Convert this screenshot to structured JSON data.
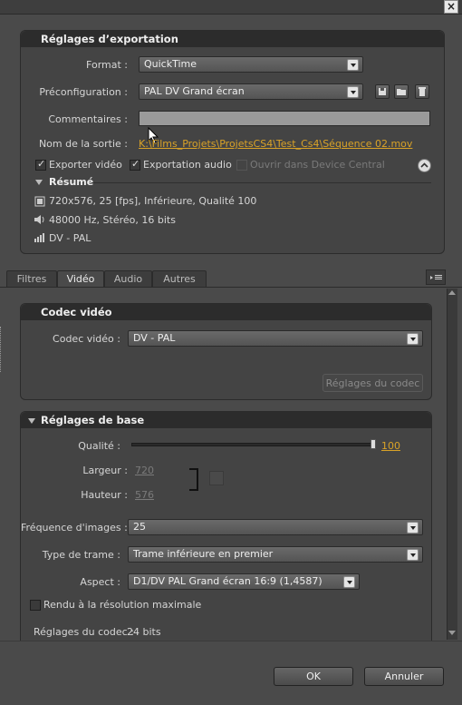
{
  "window": {
    "close_glyph": "×"
  },
  "export": {
    "panel_title": "Réglages d’exportation",
    "format_label": "Format :",
    "format_value": "QuickTime",
    "preset_label": "Préconfiguration :",
    "preset_value": "PAL DV Grand écran",
    "comments_label": "Commentaires :",
    "comments_value": "",
    "output_label": "Nom de la sortie :",
    "output_value": "K:\\Films_Projets\\ProjetsCS4\\Test_Cs4\\Séquence 02.mov",
    "export_video_label": "Exporter vidéo",
    "export_audio_label": "Exportation audio",
    "device_central_label": "Ouvrir dans Device Central",
    "summary_title": "Résumé",
    "summary_video": "720x576, 25 [fps], Inférieure, Qualité 100",
    "summary_audio": "48000 Hz, Stéréo, 16 bits",
    "summary_codec": "DV - PAL"
  },
  "tabs": [
    "Filtres",
    "Vidéo",
    "Audio",
    "Autres"
  ],
  "video_codec": {
    "panel_title": "Codec vidéo",
    "codec_label": "Codec vidéo :",
    "codec_value": "DV - PAL",
    "codec_settings_button": "Réglages du codec"
  },
  "basic": {
    "panel_title": "Réglages de base",
    "quality_label": "Qualité :",
    "quality_value": "100",
    "quality_level": 1.0,
    "width_label": "Largeur :",
    "width_value": "720",
    "height_label": "Hauteur :",
    "height_value": "576",
    "fps_label": "Fréquence d'images :",
    "fps_value": "25",
    "field_label": "Type de trame :",
    "field_value": "Trame inférieure en premier",
    "aspect_label": "Aspect :",
    "aspect_value": "D1/DV PAL Grand écran 16:9 (1,4587)",
    "max_res_label": "Rendu à la résolution maximale",
    "codec_info_label": "Réglages du codec :",
    "codec_info_value": "24 bits"
  },
  "footer": {
    "ok": "OK",
    "cancel": "Annuler"
  },
  "colors": {
    "link": "#d9a227",
    "panel_header": "#2c2c2c",
    "background": "#4a4a4a"
  }
}
